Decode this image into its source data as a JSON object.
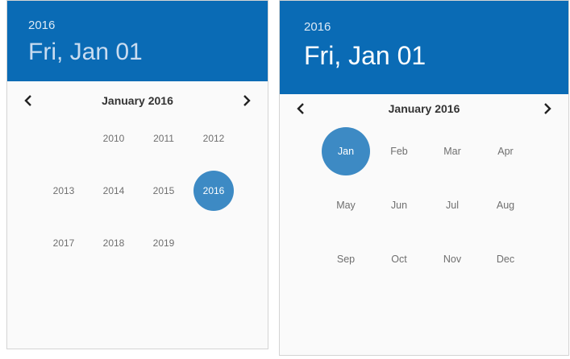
{
  "year_picker": {
    "header": {
      "year": "2016",
      "date": "Fri, Jan 01"
    },
    "nav": {
      "label": "January 2016"
    },
    "years": [
      "2010",
      "2011",
      "2012",
      "2013",
      "2014",
      "2015",
      "2016",
      "2017",
      "2018",
      "2019"
    ],
    "selected": "2016"
  },
  "month_picker": {
    "header": {
      "year": "2016",
      "date": "Fri, Jan 01"
    },
    "nav": {
      "label": "January 2016"
    },
    "months": [
      "Jan",
      "Feb",
      "Mar",
      "Apr",
      "May",
      "Jun",
      "Jul",
      "Aug",
      "Sep",
      "Oct",
      "Nov",
      "Dec"
    ],
    "selected": "Jan"
  },
  "icons": {
    "prev": "chevron-left-icon",
    "next": "chevron-right-icon"
  },
  "colors": {
    "header_bg": "#0a6bb5",
    "selected_bg": "#3d8ac4"
  }
}
